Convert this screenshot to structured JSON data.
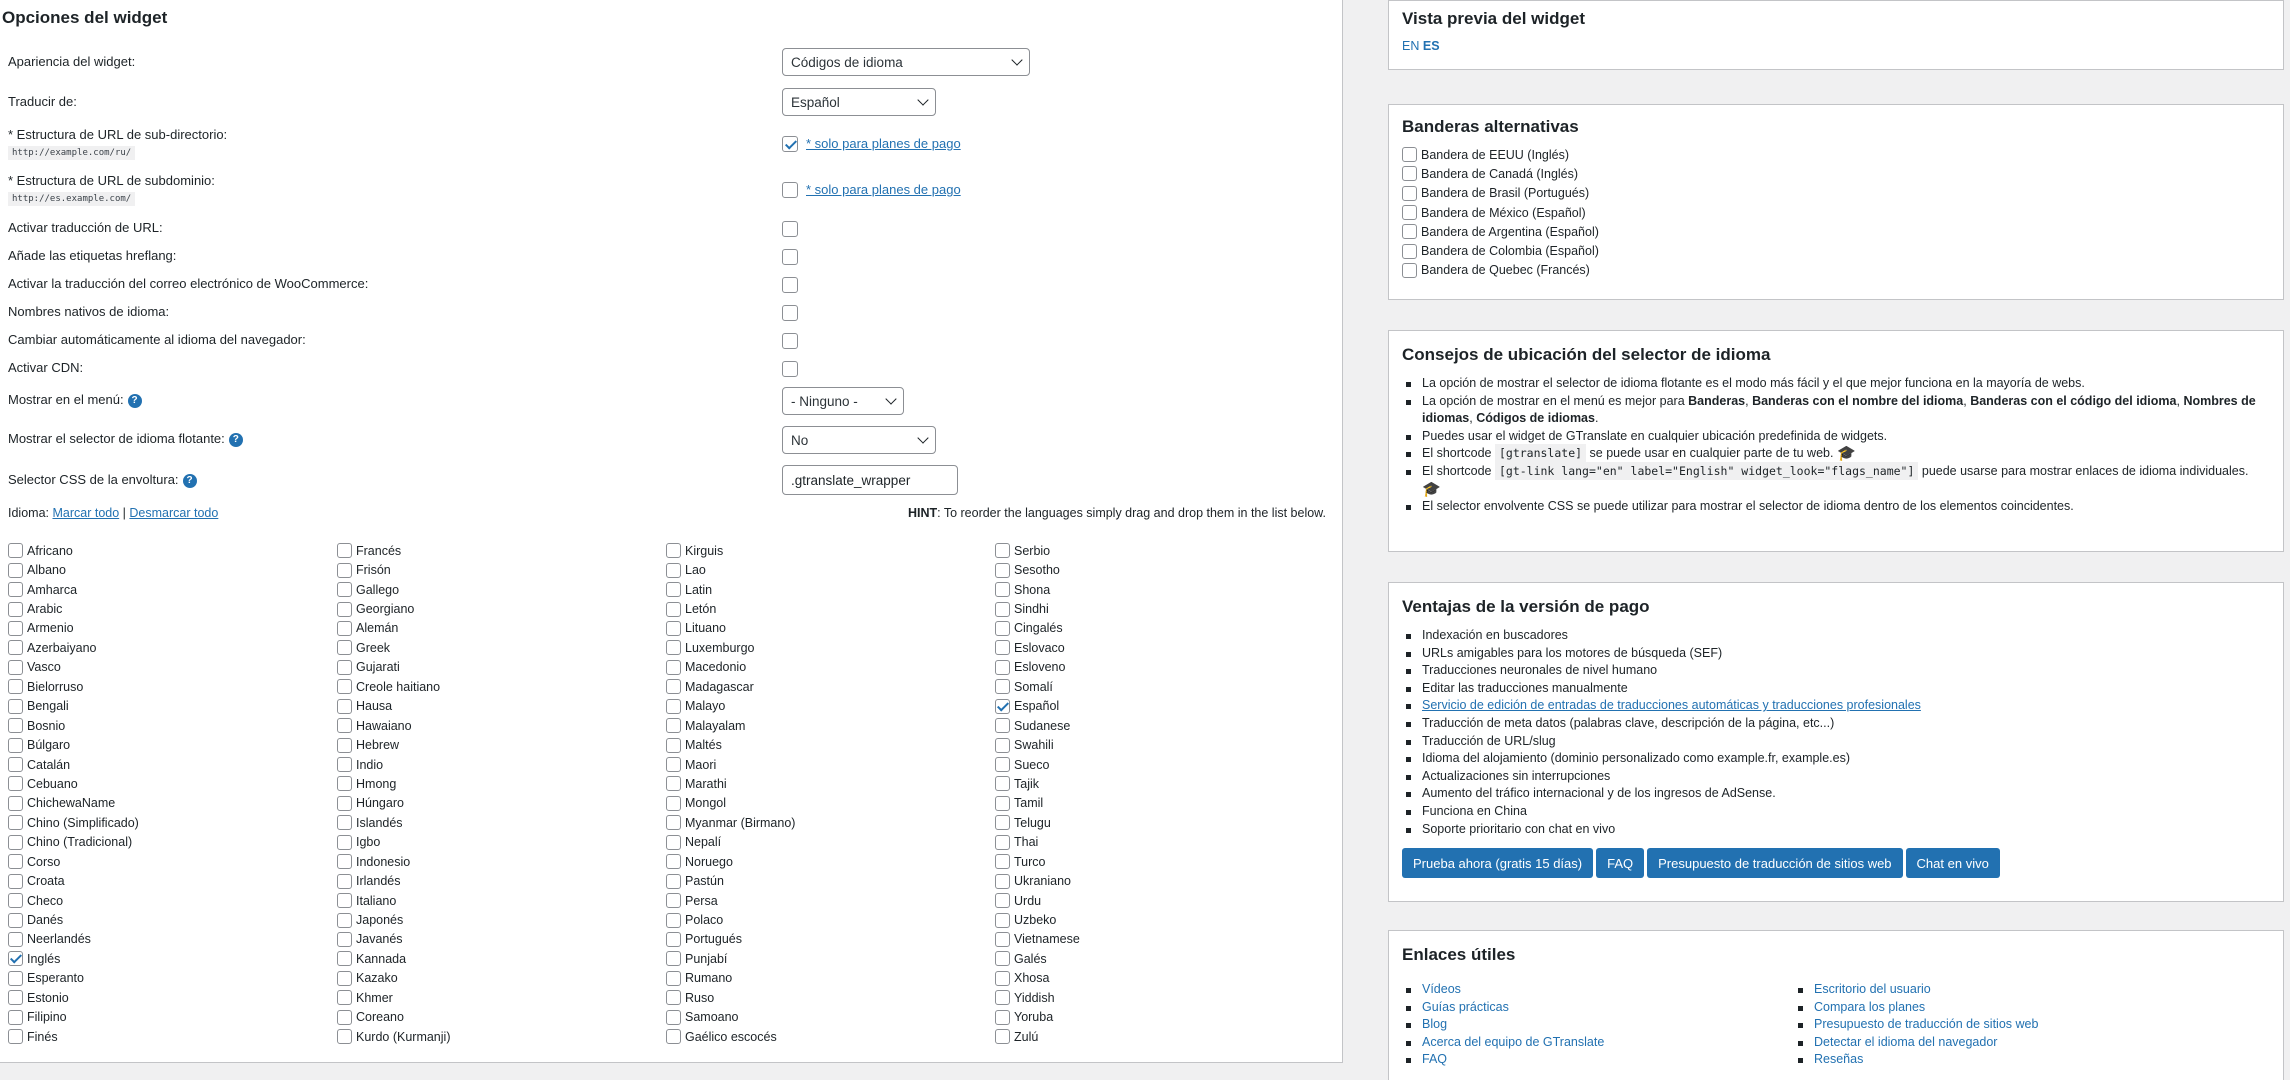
{
  "left": {
    "title": "Opciones del widget",
    "appearance": {
      "label": "Apariencia del widget:",
      "value": "Códigos de idioma"
    },
    "translate_from": {
      "label": "Traducir de:",
      "value": "Español"
    },
    "subdir": {
      "label": "* Estructura de URL de sub-directorio:",
      "example": "http://example.com/ru/",
      "link": "* solo para planes de pago"
    },
    "subdomain": {
      "label": "* Estructura de URL de subdominio:",
      "example": "http://es.example.com/",
      "link": "* solo para planes de pago"
    },
    "url_translation": "Activar traducción de URL:",
    "hreflang": "Añade las etiquetas hreflang:",
    "woo": "Activar la traducción del correo electrónico de WooCommerce:",
    "native_names": "Nombres nativos de idioma:",
    "auto_switch": "Cambiar automáticamente al idioma del navegador:",
    "cdn": "Activar CDN:",
    "menu": {
      "label": "Mostrar en el menú:",
      "value": "- Ninguno -"
    },
    "floating": {
      "label": "Mostrar el selector de idioma flotante:",
      "value": "No"
    },
    "css_selector": {
      "label": "Selector CSS de la envoltura:",
      "value": ".gtranslate_wrapper"
    },
    "languages_label": "Idioma:",
    "check_all": "Marcar todo",
    "separator": "|",
    "uncheck_all": "Desmarcar todo",
    "hint_bold": "HINT",
    "hint_text": ": To reorder the languages simply drag and drop them in the list below.",
    "languages": [
      {
        "name": "Africano",
        "checked": false
      },
      {
        "name": "Albano",
        "checked": false
      },
      {
        "name": "Amharca",
        "checked": false
      },
      {
        "name": "Arabic",
        "checked": false
      },
      {
        "name": "Armenio",
        "checked": false
      },
      {
        "name": "Azerbaiyano",
        "checked": false
      },
      {
        "name": "Vasco",
        "checked": false
      },
      {
        "name": "Bielorruso",
        "checked": false
      },
      {
        "name": "Bengali",
        "checked": false
      },
      {
        "name": "Bosnio",
        "checked": false
      },
      {
        "name": "Búlgaro",
        "checked": false
      },
      {
        "name": "Catalán",
        "checked": false
      },
      {
        "name": "Cebuano",
        "checked": false
      },
      {
        "name": "ChichewaName",
        "checked": false
      },
      {
        "name": "Chino (Simplificado)",
        "checked": false
      },
      {
        "name": "Chino (Tradicional)",
        "checked": false
      },
      {
        "name": "Corso",
        "checked": false
      },
      {
        "name": "Croata",
        "checked": false
      },
      {
        "name": "Checo",
        "checked": false
      },
      {
        "name": "Danés",
        "checked": false
      },
      {
        "name": "Neerlandés",
        "checked": false
      },
      {
        "name": "Inglés",
        "checked": true
      },
      {
        "name": "Esperanto",
        "checked": false
      },
      {
        "name": "Estonio",
        "checked": false
      },
      {
        "name": "Filipino",
        "checked": false
      },
      {
        "name": "Finés",
        "checked": false
      },
      {
        "name": "Francés",
        "checked": false
      },
      {
        "name": "Frisón",
        "checked": false
      },
      {
        "name": "Gallego",
        "checked": false
      },
      {
        "name": "Georgiano",
        "checked": false
      },
      {
        "name": "Alemán",
        "checked": false
      },
      {
        "name": "Greek",
        "checked": false
      },
      {
        "name": "Gujarati",
        "checked": false
      },
      {
        "name": "Creole haitiano",
        "checked": false
      },
      {
        "name": "Hausa",
        "checked": false
      },
      {
        "name": "Hawaiano",
        "checked": false
      },
      {
        "name": "Hebrew",
        "checked": false
      },
      {
        "name": "Indio",
        "checked": false
      },
      {
        "name": "Hmong",
        "checked": false
      },
      {
        "name": "Húngaro",
        "checked": false
      },
      {
        "name": "Islandés",
        "checked": false
      },
      {
        "name": "Igbo",
        "checked": false
      },
      {
        "name": "Indonesio",
        "checked": false
      },
      {
        "name": "Irlandés",
        "checked": false
      },
      {
        "name": "Italiano",
        "checked": false
      },
      {
        "name": "Japonés",
        "checked": false
      },
      {
        "name": "Javanés",
        "checked": false
      },
      {
        "name": "Kannada",
        "checked": false
      },
      {
        "name": "Kazako",
        "checked": false
      },
      {
        "name": "Khmer",
        "checked": false
      },
      {
        "name": "Coreano",
        "checked": false
      },
      {
        "name": "Kurdo (Kurmanji)",
        "checked": false
      },
      {
        "name": "Kirguis",
        "checked": false
      },
      {
        "name": "Lao",
        "checked": false
      },
      {
        "name": "Latin",
        "checked": false
      },
      {
        "name": "Letón",
        "checked": false
      },
      {
        "name": "Lituano",
        "checked": false
      },
      {
        "name": "Luxemburgo",
        "checked": false
      },
      {
        "name": "Macedonio",
        "checked": false
      },
      {
        "name": "Madagascar",
        "checked": false
      },
      {
        "name": "Malayo",
        "checked": false
      },
      {
        "name": "Malayalam",
        "checked": false
      },
      {
        "name": "Maltés",
        "checked": false
      },
      {
        "name": "Maori",
        "checked": false
      },
      {
        "name": "Marathi",
        "checked": false
      },
      {
        "name": "Mongol",
        "checked": false
      },
      {
        "name": "Myanmar (Birmano)",
        "checked": false
      },
      {
        "name": "Nepalí",
        "checked": false
      },
      {
        "name": "Noruego",
        "checked": false
      },
      {
        "name": "Pastún",
        "checked": false
      },
      {
        "name": "Persa",
        "checked": false
      },
      {
        "name": "Polaco",
        "checked": false
      },
      {
        "name": "Portugués",
        "checked": false
      },
      {
        "name": "Punjabí",
        "checked": false
      },
      {
        "name": "Rumano",
        "checked": false
      },
      {
        "name": "Ruso",
        "checked": false
      },
      {
        "name": "Samoano",
        "checked": false
      },
      {
        "name": "Gaélico escocés",
        "checked": false
      },
      {
        "name": "Serbio",
        "checked": false
      },
      {
        "name": "Sesotho",
        "checked": false
      },
      {
        "name": "Shona",
        "checked": false
      },
      {
        "name": "Sindhi",
        "checked": false
      },
      {
        "name": "Cingalés",
        "checked": false
      },
      {
        "name": "Eslovaco",
        "checked": false
      },
      {
        "name": "Esloveno",
        "checked": false
      },
      {
        "name": "Somalí",
        "checked": false
      },
      {
        "name": "Español",
        "checked": true
      },
      {
        "name": "Sudanese",
        "checked": false
      },
      {
        "name": "Swahili",
        "checked": false
      },
      {
        "name": "Sueco",
        "checked": false
      },
      {
        "name": "Tajik",
        "checked": false
      },
      {
        "name": "Tamil",
        "checked": false
      },
      {
        "name": "Telugu",
        "checked": false
      },
      {
        "name": "Thai",
        "checked": false
      },
      {
        "name": "Turco",
        "checked": false
      },
      {
        "name": "Ukraniano",
        "checked": false
      },
      {
        "name": "Urdu",
        "checked": false
      },
      {
        "name": "Uzbeko",
        "checked": false
      },
      {
        "name": "Vietnamese",
        "checked": false
      },
      {
        "name": "Galés",
        "checked": false
      },
      {
        "name": "Xhosa",
        "checked": false
      },
      {
        "name": "Yiddish",
        "checked": false
      },
      {
        "name": "Yoruba",
        "checked": false
      },
      {
        "name": "Zulú",
        "checked": false
      }
    ]
  },
  "preview": {
    "title": "Vista previa del widget",
    "en": "EN",
    "es": "ES"
  },
  "alt_flags": {
    "title": "Banderas alternativas",
    "items": [
      "Bandera de EEUU (Inglés)",
      "Bandera de Canadá (Inglés)",
      "Bandera de Brasil (Portugués)",
      "Bandera de México (Español)",
      "Bandera de Argentina (Español)",
      "Bandera de Colombia (Español)",
      "Bandera de Quebec (Francés)"
    ]
  },
  "tips": {
    "title": "Consejos de ubicación del selector de idioma",
    "t1": "La opción de mostrar el selector de idioma flotante es el modo más fácil y el que mejor funciona en la mayoría de webs.",
    "t2a": "La opción de mostrar en el menú es mejor para ",
    "t2b": "Banderas",
    "t2c": ", ",
    "t2d": "Banderas con el nombre del idioma",
    "t2e": ", ",
    "t2f": "Banderas con el código del idioma",
    "t2g": ", ",
    "t2h": "Nombres de idiomas",
    "t2i": ", ",
    "t2j": "Códigos de idiomas",
    "t2k": ".",
    "t3": "Puedes usar el widget de GTranslate en cualquier ubicación predefinida de widgets.",
    "t4a": "El shortcode ",
    "t4code": "[gtranslate]",
    "t4b": " se puede usar en cualquier parte de tu web.",
    "t5a": "El shortcode ",
    "t5code": "[gt-link lang=\"en\" label=\"English\" widget_look=\"flags_name\"]",
    "t5b": " puede usarse para mostrar enlaces de idioma individuales.",
    "t6": "El selector envolvente CSS se puede utilizar para mostrar el selector de idioma dentro de los elementos coincidentes."
  },
  "paid": {
    "title": "Ventajas de la versión de pago",
    "items": [
      "Indexación en buscadores",
      "URLs amigables para los motores de búsqueda (SEF)",
      "Traducciones neuronales de nivel humano",
      "Editar las traducciones manualmente",
      "Servicio de edición de entradas de traducciones automáticas y traducciones profesionales",
      "Traducción de meta datos (palabras clave, descripción de la página, etc...)",
      "Traducción de URL/slug",
      "Idioma del alojamiento (dominio personalizado como example.fr, example.es)",
      "Actualizaciones sin interrupciones",
      "Aumento del tráfico internacional y de los ingresos de AdSense.",
      "Funciona en China",
      "Soporte prioritario con chat en vivo"
    ],
    "buttons": [
      "Prueba ahora (gratis 15 días)",
      "FAQ",
      "Presupuesto de traducción de sitios web",
      "Chat en vivo"
    ]
  },
  "links": {
    "title": "Enlaces útiles",
    "col1": [
      "Vídeos",
      "Guías prácticas",
      "Blog",
      "Acerca del equipo de GTranslate",
      "FAQ"
    ],
    "col2": [
      "Escritorio del usuario",
      "Compara los planes",
      "Presupuesto de traducción de sitios web",
      "Detectar el idioma del navegador",
      "Reseñas"
    ]
  }
}
